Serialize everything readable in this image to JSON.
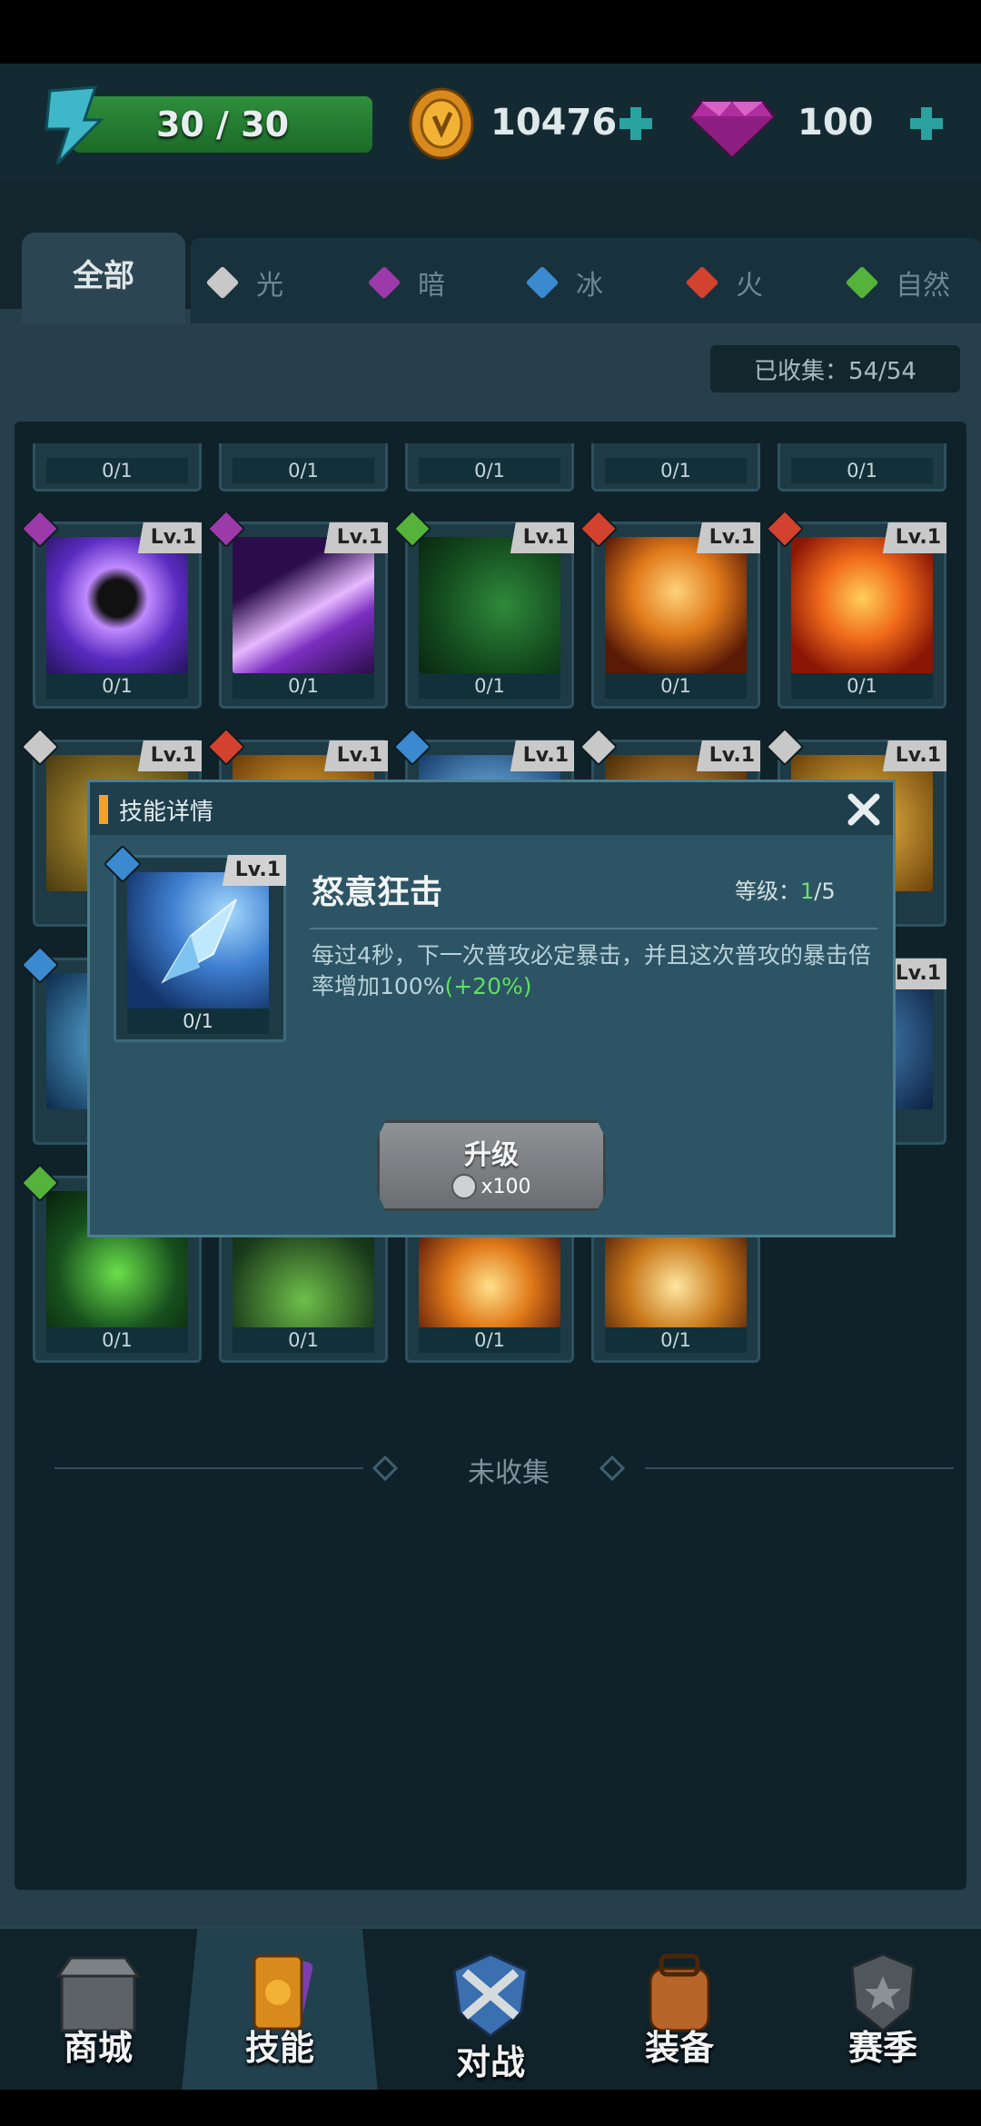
{
  "resources": {
    "energy_text": "30 / 30",
    "energy_fraction": 1.0,
    "coins": "10476",
    "gems": "100"
  },
  "tabs": [
    {
      "label": "全部",
      "color": "#cfd6d8"
    },
    {
      "label": "光",
      "color": "#c8c8c8"
    },
    {
      "label": "暗",
      "color": "#9b3aa8"
    },
    {
      "label": "冰",
      "color": "#3b8ad0"
    },
    {
      "label": "火",
      "color": "#d2422f"
    },
    {
      "label": "自然",
      "color": "#55b23a"
    }
  ],
  "collected": "已收集：54/54",
  "grid": {
    "top_row_counts": [
      "0/1",
      "0/1",
      "0/1",
      "0/1",
      "0/1"
    ],
    "row2": [
      {
        "level": "Lv.1",
        "count": "0/1",
        "element_color": "#9b3aa8",
        "art": "silhouette-glow"
      },
      {
        "level": "Lv.1",
        "count": "0/1",
        "element_color": "#9b3aa8",
        "art": "purple-streak"
      },
      {
        "level": "Lv.1",
        "count": "0/1",
        "element_color": "#55b23a",
        "art": "green-bow"
      },
      {
        "level": "Lv.1",
        "count": "0/1",
        "element_color": "#d2422f",
        "art": "fire-skeleton"
      },
      {
        "level": "Lv.1",
        "count": "0/1",
        "element_color": "#d2422f",
        "art": "fire-mask"
      }
    ],
    "row3_levels": [
      "Lv.1",
      "Lv.1",
      "Lv.1",
      "Lv.1",
      "Lv.1"
    ],
    "row4_level": "Lv.1",
    "row5_counts": [
      "0/1",
      "0/1",
      "0/1",
      "0/1"
    ]
  },
  "divider_label": "未收集",
  "modal": {
    "title": "技能详情",
    "skill_level_badge": "Lv.1",
    "skill_count": "0/1",
    "skill_name": "怒意狂击",
    "level_label": "等级：",
    "level_current": "1",
    "level_max": "/5",
    "description": "每过4秒，下一次普攻必定暴击，并且这次普攻的暴击倍率增加100%",
    "bonus": "(+20%)",
    "upgrade_label": "升级",
    "upgrade_cost": "x100"
  },
  "nav": [
    {
      "label": "商城",
      "icon": "shop-icon"
    },
    {
      "label": "技能",
      "icon": "skill-book-icon"
    },
    {
      "label": "对战",
      "icon": "crossed-swords-icon"
    },
    {
      "label": "装备",
      "icon": "backpack-icon"
    },
    {
      "label": "赛季",
      "icon": "season-badge-icon"
    }
  ]
}
